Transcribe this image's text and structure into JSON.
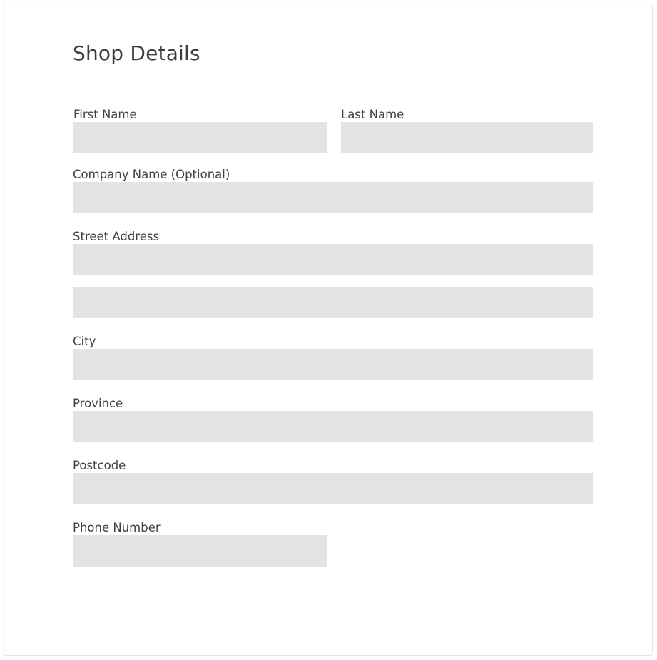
{
  "form": {
    "title": "Shop Details",
    "first_name": {
      "label": "First Name",
      "value": "",
      "placeholder": ""
    },
    "last_name": {
      "label": "Last Name",
      "value": "",
      "placeholder": ""
    },
    "company_name": {
      "label": "Company Name (Optional)",
      "value": "",
      "placeholder": ""
    },
    "street_address": {
      "label": "Street Address",
      "line1_value": "",
      "line2_value": "",
      "placeholder": ""
    },
    "city": {
      "label": "City",
      "value": "",
      "placeholder": ""
    },
    "province": {
      "label": "Province",
      "value": "",
      "placeholder": ""
    },
    "postcode": {
      "label": "Postcode",
      "value": "",
      "placeholder": ""
    },
    "phone_number": {
      "label": "Phone Number",
      "value": "",
      "placeholder": ""
    }
  },
  "colors": {
    "field_background": "#e3e3e3",
    "text": "#404040",
    "card_background": "#ffffff"
  }
}
